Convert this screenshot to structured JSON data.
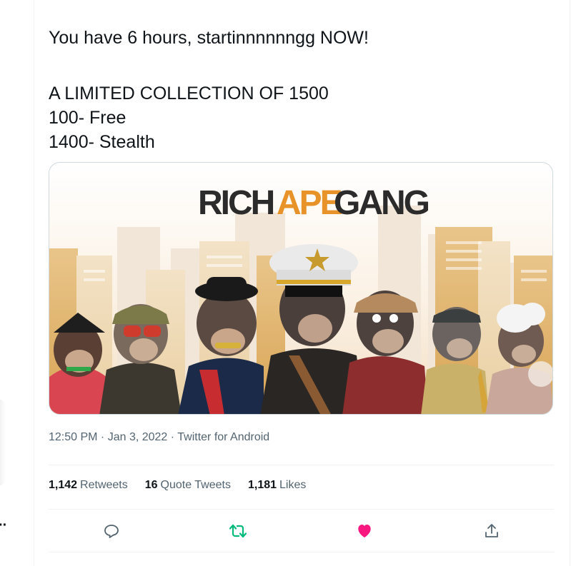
{
  "tweet": {
    "lines": [
      "You have 6 hours, startinnnnnngg NOW!",
      "A LIMITED COLLECTION OF 1500",
      "100- Free",
      "1400- Stealth"
    ],
    "media": {
      "logo_rich": "RICH",
      "logo_ape": "APE",
      "logo_gang": "GANG",
      "logo_colors": {
        "dark": "#2b2b2b",
        "orange": "#e8922a"
      }
    },
    "timestamp": "12:50 PM · Jan 3, 2022 · Twitter for Android"
  },
  "stats": {
    "retweets_count": "1,142",
    "retweets_label": "Retweets",
    "quotes_count": "16",
    "quotes_label": "Quote Tweets",
    "likes_count": "1,181",
    "likes_label": "Likes"
  },
  "actions": {
    "reply_icon": "reply-icon",
    "retweet_icon": "retweet-icon",
    "like_icon": "heart-filled-icon",
    "share_icon": "share-icon"
  },
  "colors": {
    "retweet_active": "#00ba7c",
    "like_active": "#f91880",
    "text_secondary": "#536471"
  },
  "left_rail": {
    "more_icon": "more-dots-icon"
  }
}
